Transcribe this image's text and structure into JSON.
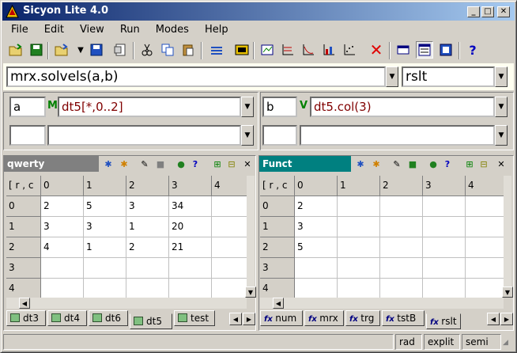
{
  "window": {
    "title": "Sicyon Lite 4.0",
    "minimize": "_",
    "maximize": "□",
    "close": "✕"
  },
  "menu": [
    "File",
    "Edit",
    "View",
    "Run",
    "Modes",
    "Help"
  ],
  "command": {
    "expression": "mrx.solvels(a,b)",
    "result_var": "rslt"
  },
  "left_input": {
    "var": "a",
    "mode": "M",
    "expr": "dt5[*,0..2]"
  },
  "right_input": {
    "var": "b",
    "mode": "V",
    "expr": "dt5.col(3)"
  },
  "left_panel": {
    "title": "qwerty",
    "corner": "[ r , c",
    "columns": [
      "0",
      "1",
      "2",
      "3",
      "4"
    ],
    "rows": [
      {
        "label": "0",
        "cells": [
          "2",
          "5",
          "3",
          "34",
          ""
        ]
      },
      {
        "label": "1",
        "cells": [
          "3",
          "3",
          "1",
          "20",
          ""
        ]
      },
      {
        "label": "2",
        "cells": [
          "4",
          "1",
          "2",
          "21",
          ""
        ]
      },
      {
        "label": "3",
        "cells": [
          "",
          "",
          "",
          "",
          ""
        ]
      },
      {
        "label": "4",
        "cells": [
          "",
          "",
          "",
          "",
          ""
        ]
      }
    ],
    "tabs": [
      "dt3",
      "dt4",
      "dt6",
      "dt5",
      "test"
    ],
    "active_tab": "dt5"
  },
  "right_panel": {
    "title": "Funct",
    "corner": "[ r , c",
    "columns": [
      "0",
      "1",
      "2",
      "3",
      "4"
    ],
    "rows": [
      {
        "label": "0",
        "cells": [
          "2",
          "",
          "",
          "",
          ""
        ]
      },
      {
        "label": "1",
        "cells": [
          "3",
          "",
          "",
          "",
          ""
        ]
      },
      {
        "label": "2",
        "cells": [
          "5",
          "",
          "",
          "",
          ""
        ]
      },
      {
        "label": "3",
        "cells": [
          "",
          "",
          "",
          "",
          ""
        ]
      },
      {
        "label": "4",
        "cells": [
          "",
          "",
          "",
          "",
          ""
        ]
      }
    ],
    "tabs": [
      "num",
      "mrx",
      "trg",
      "tstB",
      "rslt"
    ],
    "active_tab": "rslt"
  },
  "status": {
    "angle": "rad",
    "mode": "explit",
    "sep": "semi"
  },
  "colors": {
    "title_start": "#0a246a",
    "title_end": "#a6caf0",
    "left_header": "#808080",
    "right_header": "#008080",
    "expr_text": "#800000"
  }
}
